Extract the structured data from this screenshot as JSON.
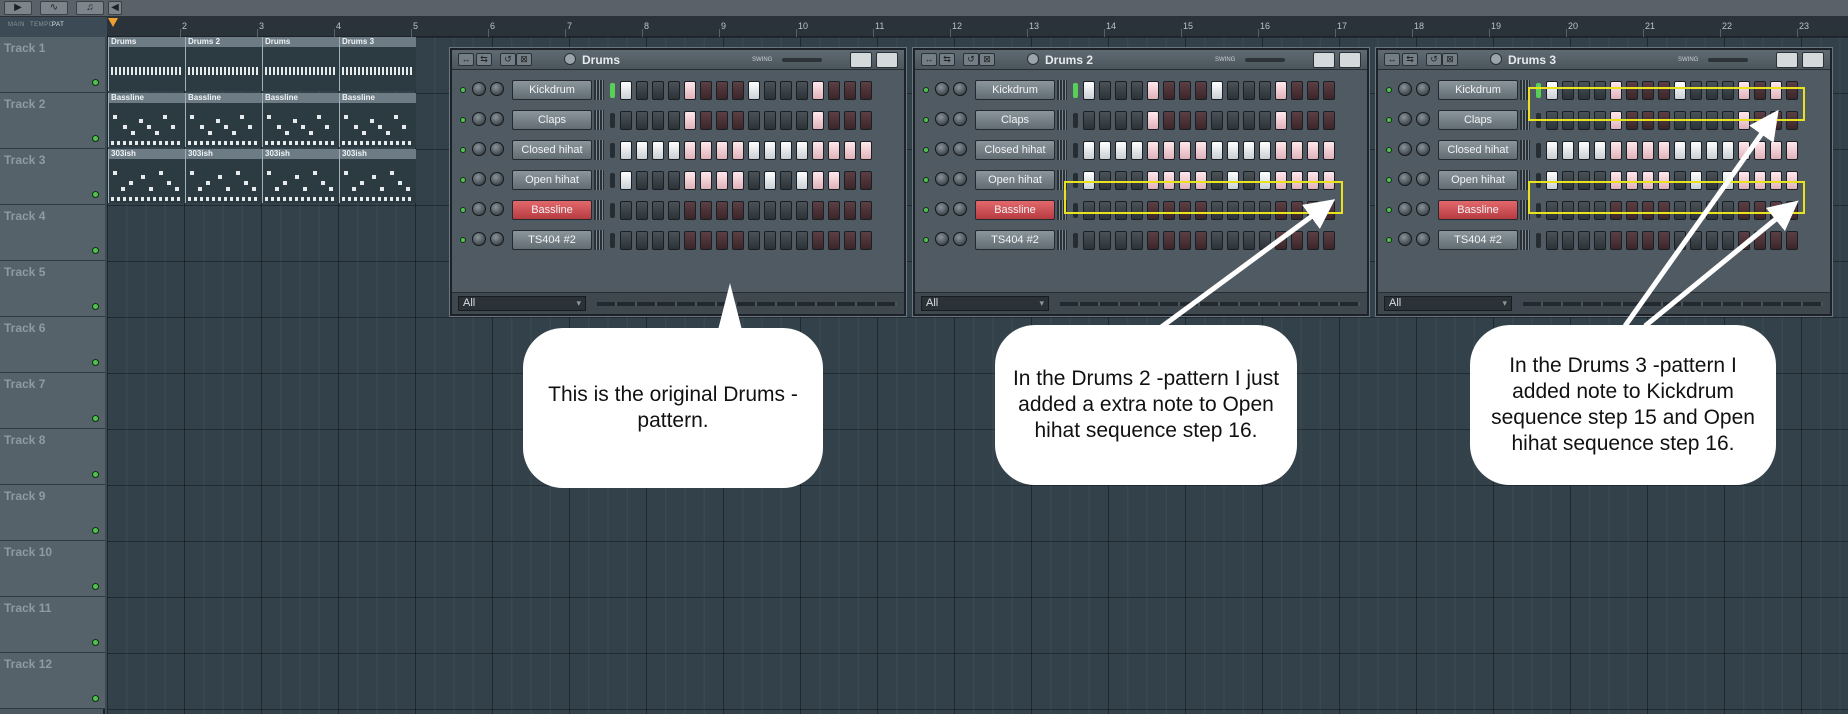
{
  "toolbar": {
    "buttons": [
      "▶",
      "∿",
      "♫",
      "◀"
    ],
    "mode_labels": [
      "MAIN",
      "TEMPO",
      "PAT"
    ]
  },
  "ruler": {
    "bars": [
      "2",
      "3",
      "4",
      "5",
      "6",
      "7",
      "8",
      "9",
      "10",
      "11",
      "12",
      "13",
      "14",
      "15",
      "16",
      "17",
      "18",
      "19",
      "20",
      "21",
      "22",
      "23"
    ]
  },
  "tracks": [
    "Track 1",
    "Track 2",
    "Track 3",
    "Track 4",
    "Track 5",
    "Track 6",
    "Track 7",
    "Track 8",
    "Track 9",
    "Track 10",
    "Track 11",
    "Track 12"
  ],
  "clips": {
    "track1": [
      "Drums",
      "Drums 2",
      "Drums",
      "Drums 3"
    ],
    "track2": [
      "Bassline",
      "Bassline",
      "Bassline",
      "Bassline"
    ],
    "track3": [
      "303ish",
      "303ish",
      "303ish",
      "303ish"
    ]
  },
  "racks": [
    {
      "title": "Drums",
      "swing": "SWING",
      "filter": "All",
      "channels": [
        {
          "name": "Kickdrum",
          "red": false,
          "selected": true
        },
        {
          "name": "Claps",
          "red": false,
          "selected": false
        },
        {
          "name": "Closed hihat",
          "red": false,
          "selected": false
        },
        {
          "name": "Open hihat",
          "red": false,
          "selected": false
        },
        {
          "name": "Bassline",
          "red": true,
          "selected": false
        },
        {
          "name": "TS404 #2",
          "red": false,
          "selected": false
        }
      ],
      "steps": [
        [
          1,
          0,
          0,
          0,
          1,
          0,
          0,
          0,
          1,
          0,
          0,
          0,
          1,
          0,
          0,
          0
        ],
        [
          0,
          0,
          0,
          0,
          1,
          0,
          0,
          0,
          0,
          0,
          0,
          0,
          1,
          0,
          0,
          0
        ],
        [
          1,
          1,
          1,
          1,
          1,
          1,
          1,
          1,
          1,
          1,
          1,
          1,
          1,
          1,
          1,
          1
        ],
        [
          1,
          0,
          0,
          0,
          1,
          1,
          1,
          1,
          0,
          1,
          0,
          1,
          1,
          1,
          0,
          0
        ],
        [
          0,
          0,
          0,
          0,
          0,
          0,
          0,
          0,
          0,
          0,
          0,
          0,
          0,
          0,
          0,
          0
        ],
        [
          0,
          0,
          0,
          0,
          0,
          0,
          0,
          0,
          0,
          0,
          0,
          0,
          0,
          0,
          0,
          0
        ]
      ]
    },
    {
      "title": "Drums 2",
      "swing": "SWING",
      "filter": "All",
      "channels": [
        {
          "name": "Kickdrum",
          "red": false,
          "selected": true
        },
        {
          "name": "Claps",
          "red": false,
          "selected": false
        },
        {
          "name": "Closed hihat",
          "red": false,
          "selected": false
        },
        {
          "name": "Open hihat",
          "red": false,
          "selected": false
        },
        {
          "name": "Bassline",
          "red": true,
          "selected": false
        },
        {
          "name": "TS404 #2",
          "red": false,
          "selected": false
        }
      ],
      "steps": [
        [
          1,
          0,
          0,
          0,
          1,
          0,
          0,
          0,
          1,
          0,
          0,
          0,
          1,
          0,
          0,
          0
        ],
        [
          0,
          0,
          0,
          0,
          1,
          0,
          0,
          0,
          0,
          0,
          0,
          0,
          1,
          0,
          0,
          0
        ],
        [
          1,
          1,
          1,
          1,
          1,
          1,
          1,
          1,
          1,
          1,
          1,
          1,
          1,
          1,
          1,
          1
        ],
        [
          1,
          0,
          0,
          0,
          1,
          1,
          1,
          1,
          0,
          1,
          0,
          1,
          1,
          1,
          1,
          1
        ],
        [
          0,
          0,
          0,
          0,
          0,
          0,
          0,
          0,
          0,
          0,
          0,
          0,
          0,
          0,
          0,
          0
        ],
        [
          0,
          0,
          0,
          0,
          0,
          0,
          0,
          0,
          0,
          0,
          0,
          0,
          0,
          0,
          0,
          0
        ]
      ]
    },
    {
      "title": "Drums 3",
      "swing": "SWING",
      "filter": "All",
      "channels": [
        {
          "name": "Kickdrum",
          "red": false,
          "selected": true
        },
        {
          "name": "Claps",
          "red": false,
          "selected": false
        },
        {
          "name": "Closed hihat",
          "red": false,
          "selected": false
        },
        {
          "name": "Open hihat",
          "red": false,
          "selected": false
        },
        {
          "name": "Bassline",
          "red": true,
          "selected": false
        },
        {
          "name": "TS404 #2",
          "red": false,
          "selected": false
        }
      ],
      "steps": [
        [
          1,
          0,
          0,
          0,
          1,
          0,
          0,
          0,
          1,
          0,
          0,
          0,
          1,
          0,
          1,
          0
        ],
        [
          0,
          0,
          0,
          0,
          1,
          0,
          0,
          0,
          0,
          0,
          0,
          0,
          1,
          0,
          0,
          0
        ],
        [
          1,
          1,
          1,
          1,
          1,
          1,
          1,
          1,
          1,
          1,
          1,
          1,
          1,
          1,
          1,
          1
        ],
        [
          1,
          0,
          0,
          0,
          1,
          1,
          1,
          1,
          0,
          1,
          0,
          1,
          1,
          1,
          1,
          1
        ],
        [
          0,
          0,
          0,
          0,
          0,
          0,
          0,
          0,
          0,
          0,
          0,
          0,
          0,
          0,
          0,
          0
        ],
        [
          0,
          0,
          0,
          0,
          0,
          0,
          0,
          0,
          0,
          0,
          0,
          0,
          0,
          0,
          0,
          0
        ]
      ]
    }
  ],
  "callouts": {
    "original": "This is the original Drums -pattern.",
    "drums2": "In the Drums 2 -pattern I just added a extra note to Open hihat sequence step 16.",
    "drums3": "In the Drums 3 -pattern I added note to Kickdrum sequence step 15 and Open hihat sequence step 16."
  },
  "colors": {
    "highlight": "#e9e21e",
    "arrow": "#ffffff",
    "step_on": "#ffffff",
    "red_channel": "#d04a50"
  }
}
